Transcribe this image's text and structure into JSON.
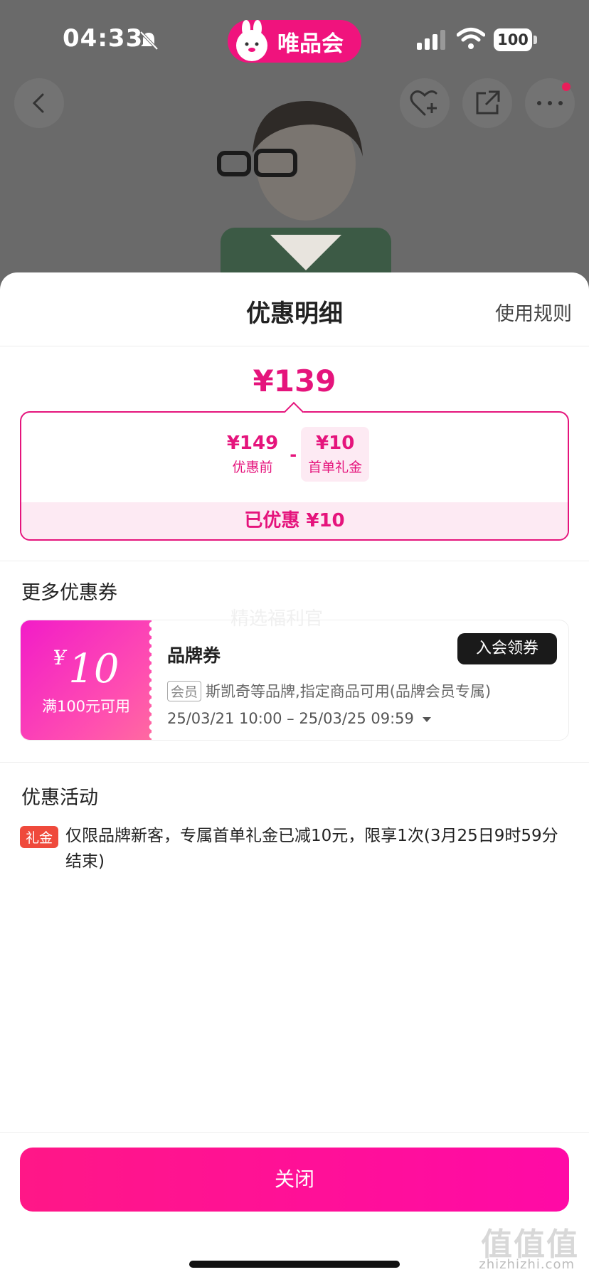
{
  "status_bar": {
    "time": "04:33",
    "battery": "100"
  },
  "brand": {
    "name": "唯品会"
  },
  "sheet": {
    "title": "优惠明细",
    "rules_label": "使用规则",
    "final_price": "¥139",
    "breakdown": {
      "original_value": "¥149",
      "original_label": "优惠前",
      "minus": "-",
      "discount_value": "¥10",
      "discount_label": "首单礼金",
      "saved_text": "已优惠 ¥10"
    },
    "more_coupons_title": "更多优惠券",
    "watermark_text": "精选福利官",
    "coupon": {
      "currency": "¥",
      "amount": "10",
      "condition": "满100元可用",
      "name": "品牌券",
      "button_label": "入会领券",
      "member_tag": "会员",
      "description": "斯凯奇等品牌,指定商品可用(品牌会员专属)",
      "date_range": "25/03/21 10:00 – 25/03/25 09:59"
    },
    "activity_title": "优惠活动",
    "activity": {
      "tag": "礼金",
      "text": "仅限品牌新客，专属首单礼金已减10元，限享1次(3月25日9时59分结束)"
    },
    "close_label": "关闭"
  },
  "watermark": {
    "logo": "值值值",
    "site": "zhizhizhi.com"
  },
  "colors": {
    "accent": "#e5147c",
    "brand_pink": "#f0137d",
    "button_dark": "#1a1a1a",
    "tag_red": "#ef4a3c"
  }
}
